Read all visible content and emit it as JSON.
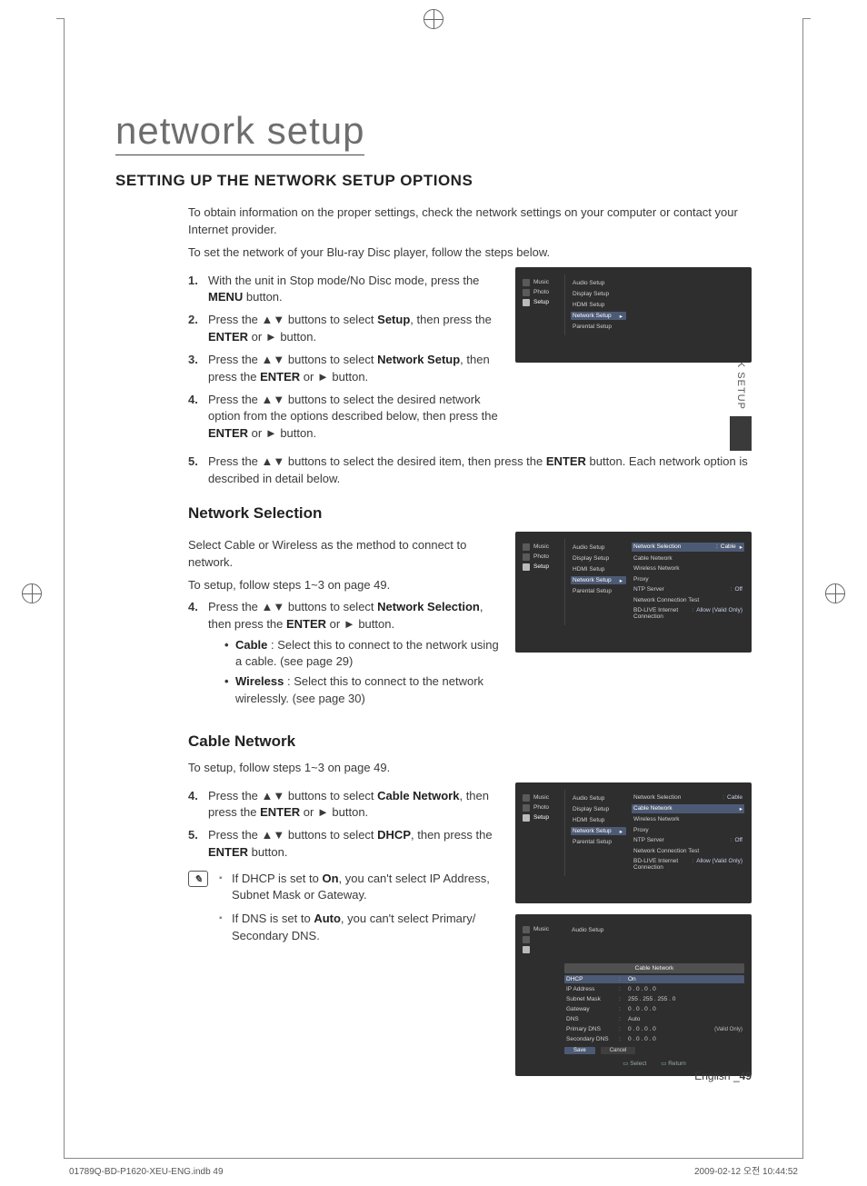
{
  "side_tab": "NETWORK SETUP",
  "title": "network setup",
  "section_title": "SETTING UP THE NETWORK SETUP OPTIONS",
  "intro_1": "To obtain information on the proper settings, check the network settings on your computer or contact your Internet provider.",
  "intro_2": "To set the network of your Blu-ray Disc player, follow the steps below.",
  "steps": {
    "s1_a": "With the unit in Stop mode/No Disc mode, press the ",
    "s1_b": "MENU",
    "s1_c": " button.",
    "s2_a": "Press the ▲▼ buttons to select ",
    "s2_b": "Setup",
    "s2_c": ", then press the ",
    "s2_d": "ENTER",
    "s2_e": " or ► button.",
    "s3_a": "Press the ▲▼ buttons to select ",
    "s3_b": "Network Setup",
    "s3_c": ", then press the ",
    "s3_d": "ENTER",
    "s3_e": " or ► button.",
    "s4_a": "Press the ▲▼ buttons to select the desired network option from the options described below, then press the ",
    "s4_b": "ENTER",
    "s4_c": " or ► button.",
    "s5_a": "Press the ▲▼ buttons to select the desired item, then press the ",
    "s5_b": "ENTER",
    "s5_c": " button. Each network option is described in detail below."
  },
  "net_sel": {
    "h": "Network Selection",
    "p1": "Select Cable or Wireless as the method to connect to network.",
    "p2": "To setup, follow steps 1~3 on page 49.",
    "s4_a": "Press the ▲▼ buttons to select ",
    "s4_b": "Network Selection",
    "s4_c": ", then press the ",
    "s4_d": "ENTER",
    "s4_e": " or ► button.",
    "bul_cable_b": "Cable",
    "bul_cable_t": " : Select this to connect to the network using a cable. (see page 29)",
    "bul_wifi_b": "Wireless",
    "bul_wifi_t": " : Select this to connect to the network wirelessly. (see page 30)"
  },
  "cable": {
    "h": "Cable Network",
    "p1": "To setup, follow steps 1~3 on page 49.",
    "s4_a": "Press the ▲▼ buttons to select ",
    "s4_b": "Cable Network",
    "s4_c": ", then press the ",
    "s4_d": "ENTER",
    "s4_e": " or ► button.",
    "s5_a": "Press the ▲▼ buttons to select ",
    "s5_b": "DHCP",
    "s5_c": ", then press the ",
    "s5_d": "ENTER",
    "s5_e": " button.",
    "note1_a": "If DHCP is set to ",
    "note1_b": "On",
    "note1_c": ", you can't select IP Address, Subnet Mask or Gateway.",
    "note2_a": "If DNS is set to ",
    "note2_b": "Auto",
    "note2_c": ", you can't select Primary/ Secondary DNS."
  },
  "ui_labels": {
    "left": {
      "music": "Music",
      "photo": "Photo",
      "setup": "Setup"
    },
    "mid": {
      "audio": "Audio Setup",
      "display": "Display Setup",
      "hdmi": "HDMI Setup",
      "network": "Network Setup",
      "parental": "Parental Setup"
    },
    "right_keys": {
      "net_sel": "Network Selection",
      "cable_net": "Cable Network",
      "wireless": "Wireless Network",
      "proxy": "Proxy",
      "ntp": "NTP Server",
      "nct": "Network Connection Test",
      "bdlive": "BD-LIVE Internet Connection"
    },
    "right_vals": {
      "cable": "Cable",
      "off": "Off",
      "allow": "Allow (Valid Only)"
    },
    "popup": {
      "title": "Cable Network",
      "dhcp": "DHCP",
      "dhcp_v": "On",
      "ip": "IP Address",
      "ip_v": "0 . 0 . 0 . 0",
      "mask": "Subnet Mask",
      "mask_v": "255 . 255 . 255 . 0",
      "gw": "Gateway",
      "gw_v": "0 . 0 . 0 . 0",
      "dns": "DNS",
      "dns_v": "Auto",
      "pdns": "Primary DNS",
      "pdns_v": "0 . 0 . 0 . 0",
      "sdns": "Secondary DNS",
      "sdns_v": "0 . 0 . 0 . 0",
      "save": "Save",
      "cancel": "Cancel",
      "select": "Select",
      "return": "Return",
      "side_note": "(Valid Only)"
    }
  },
  "footer": {
    "lang": "English ",
    "page_prefix": "_",
    "page": "49",
    "left": "01789Q-BD-P1620-XEU-ENG.indb   49",
    "right": "2009-02-12   오전 10:44:52"
  }
}
